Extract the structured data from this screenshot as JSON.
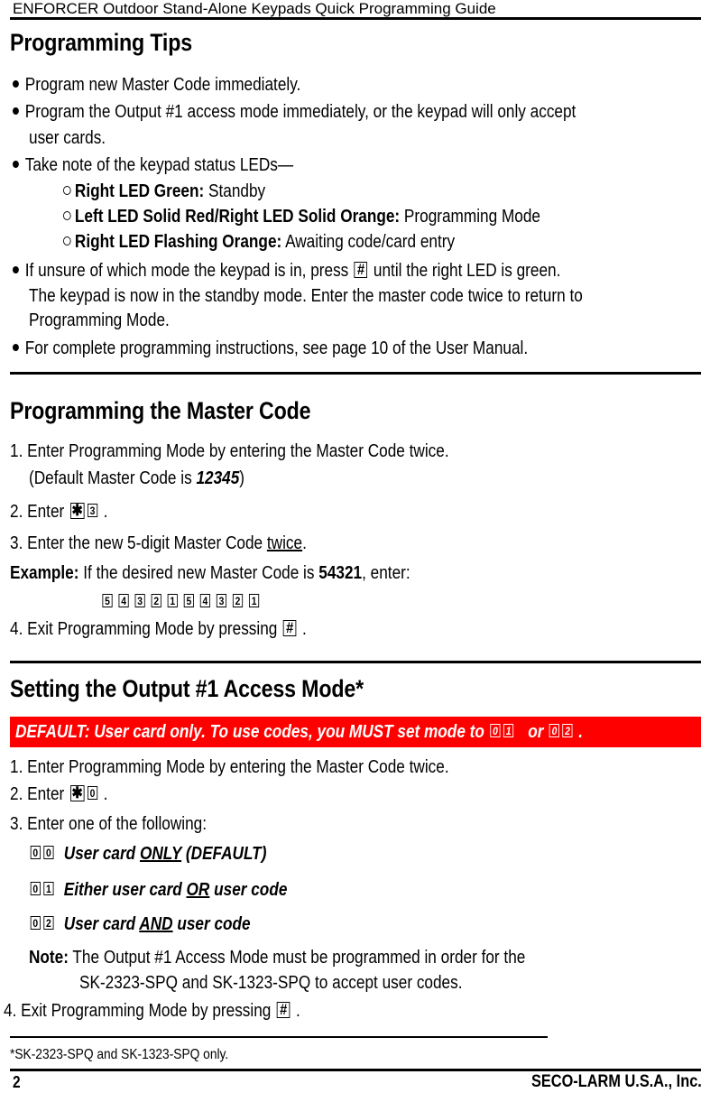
{
  "header": {
    "title": "ENFORCER Outdoor Stand-Alone Keypads Quick Programming Guide"
  },
  "tips": {
    "heading": "Programming Tips",
    "bullet1": "Program new Master Code immediately.",
    "bullet2_line1": "Program the Output #1 access mode immediately, or the keypad will only accept",
    "bullet2_line2": "user cards.",
    "bullet3": "Take note of the keypad status LEDs—",
    "leds": [
      {
        "label": "Right LED Green:",
        "desc": "Standby"
      },
      {
        "label": "Left LED Solid Red/Right LED Solid Orange:",
        "desc": "Programming Mode"
      },
      {
        "label": "Right LED Flashing Orange:",
        "desc": "Awaiting code/card entry"
      }
    ],
    "bullet4_pre": "If unsure of which mode the keypad is in, press",
    "bullet4_key": "#",
    "bullet4_post": "until the right LED is green.",
    "bullet4_line2": "The keypad is now in the standby mode.  Enter the master code twice to return to",
    "bullet4_line3": "Programming Mode.",
    "bullet5": "For complete programming instructions, see page 10 of the User Manual."
  },
  "master": {
    "heading": "Programming the Master Code",
    "step1": "1. Enter Programming Mode by entering the Master Code twice.",
    "step1_note_pre": "(Default Master Code is ",
    "step1_note_code": "12345",
    "step1_note_post": ")",
    "step2_pre": "2. Enter",
    "step2_keys": [
      "✱",
      "3"
    ],
    "step2_post": ".",
    "step3_pre": "3. Enter the new 5-digit Master Code ",
    "step3_u": "twice",
    "step3_post": ".",
    "example_label": "Example:",
    "example_pre": " If the desired new Master Code is ",
    "example_code": "54321",
    "example_post": ", enter:",
    "example_keys": [
      "5",
      "4",
      "3",
      "2",
      "1",
      "5",
      "4",
      "3",
      "2",
      "1"
    ],
    "step4_pre": "4. Exit Programming Mode by pressing",
    "step4_key": "#",
    "step4_post": "."
  },
  "output": {
    "heading": "Setting the Output #1 Access Mode*",
    "banner_pre": "DEFAULT: User card only.  To use codes, you MUST set mode to",
    "banner_keys_a": [
      "0",
      "1"
    ],
    "banner_or": "or",
    "banner_keys_b": [
      "0",
      "2"
    ],
    "banner_post": ".",
    "banner_color": "#ff0000",
    "step1": "1. Enter Programming Mode by entering the Master Code twice.",
    "step2_pre": "2. Enter",
    "step2_keys": [
      "✱",
      "0"
    ],
    "step2_post": ".",
    "step3": "3. Enter one of the following:",
    "options": [
      {
        "keys": [
          "0",
          "0"
        ],
        "pre": "User card ",
        "u": "ONLY",
        "post": " (DEFAULT)"
      },
      {
        "keys": [
          "0",
          "1"
        ],
        "pre": "Either user card ",
        "u": "OR",
        "post": " user code"
      },
      {
        "keys": [
          "0",
          "2"
        ],
        "pre": "User card ",
        "u": "AND",
        "post": " user code"
      }
    ],
    "note_label": "Note:",
    "note_line1": " The Output #1 Access Mode must be programmed in order for the",
    "note_line2": "SK-2323-SPQ and SK-1323-SPQ to accept user codes.",
    "step4_pre": "4. Exit Programming Mode by pressing",
    "step4_key": "#",
    "step4_post": "."
  },
  "footnote": "*SK-2323-SPQ and SK-1323-SPQ only.",
  "footer": {
    "page": "2",
    "company": "SECO-LARM U.S.A., Inc."
  }
}
